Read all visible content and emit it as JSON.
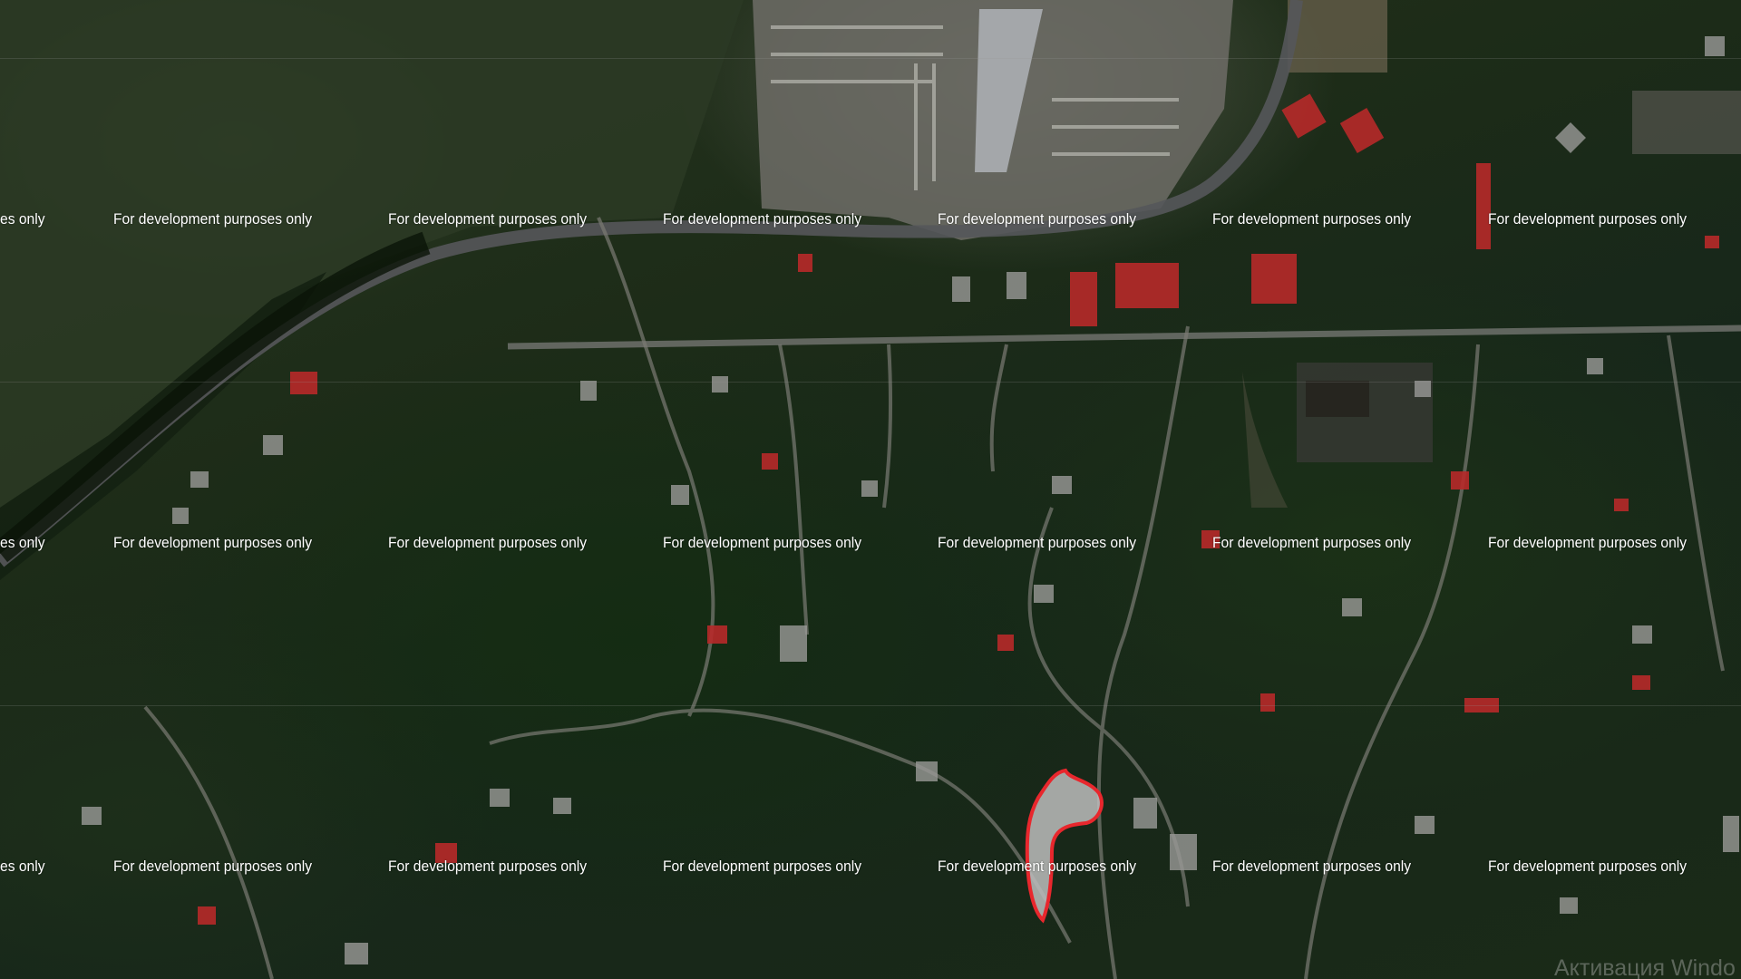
{
  "map": {
    "view": "satellite",
    "watermark_text": "For development purposes only",
    "watermark_fragment": "es only",
    "os_watermark": "Активация Windo",
    "parcel": {
      "outline_color": "#e8272d",
      "fill_color": "#bdbdbd"
    },
    "colors": {
      "vegetation": "#1d2c18",
      "roads": "#8a8a82",
      "roofs_red": "#b82a2a",
      "roofs_grey": "#9a9a98"
    }
  }
}
